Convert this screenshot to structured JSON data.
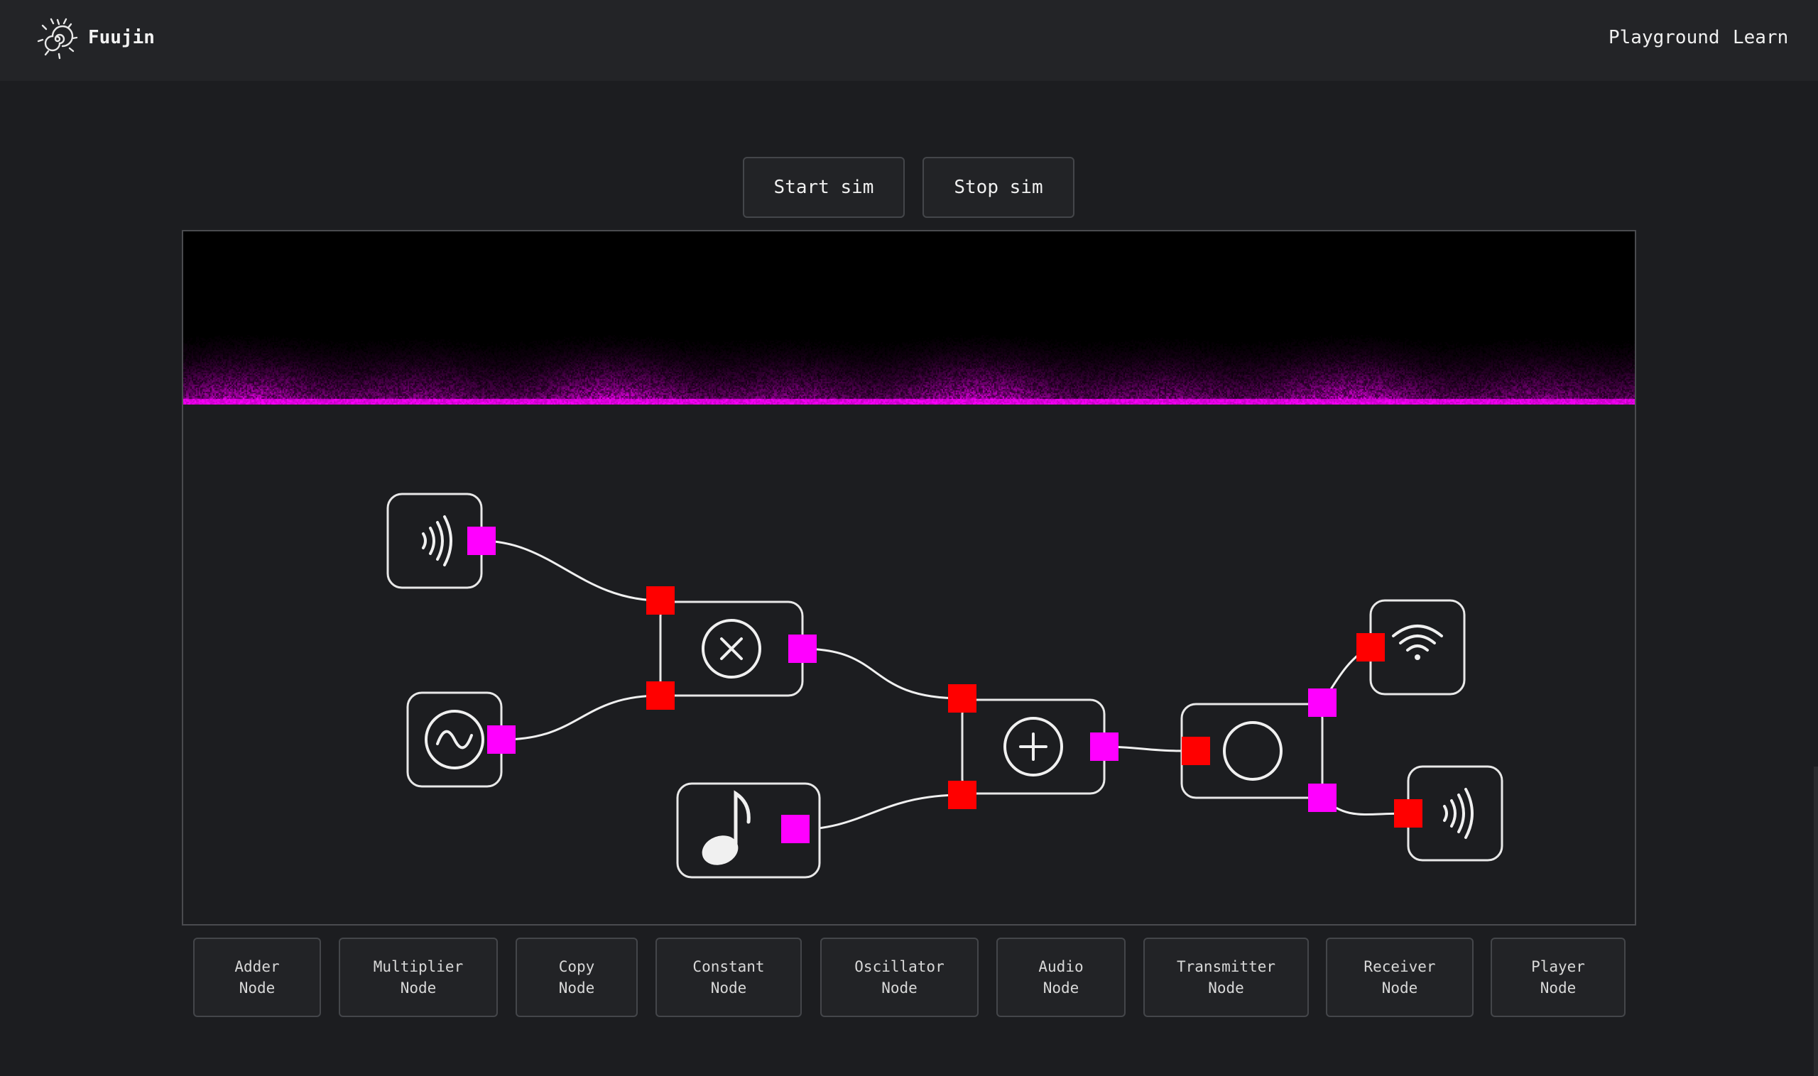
{
  "app": {
    "brand": "Fuujin",
    "logo_icon": "spiral-sun-logo"
  },
  "nav": {
    "items": [
      "Playground",
      "Learn"
    ]
  },
  "sim_controls": {
    "start_label": "Start sim",
    "stop_label": "Stop sim"
  },
  "colors": {
    "output_port": "#ff00ff",
    "input_port": "#ff0000",
    "spectrogram_accent": "#ff00ff",
    "background": "#1c1d20"
  },
  "graph": {
    "nodes": [
      {
        "id": "audio-node-1",
        "icon": "sound-waves-icon"
      },
      {
        "id": "oscillator-node",
        "icon": "sine-wave-icon"
      },
      {
        "id": "multiplier-node",
        "icon": "multiply-icon"
      },
      {
        "id": "constant-node",
        "icon": "music-note-icon"
      },
      {
        "id": "adder-node",
        "icon": "plus-icon"
      },
      {
        "id": "copy-node",
        "icon": "circle-icon"
      },
      {
        "id": "transmitter-node",
        "icon": "wifi-icon"
      },
      {
        "id": "player-node",
        "icon": "sound-waves-icon"
      }
    ]
  },
  "palette": {
    "buttons": [
      {
        "line1": "Adder",
        "line2": "Node"
      },
      {
        "line1": "Multiplier",
        "line2": "Node"
      },
      {
        "line1": "Copy",
        "line2": "Node"
      },
      {
        "line1": "Constant",
        "line2": "Node"
      },
      {
        "line1": "Oscillator",
        "line2": "Node"
      },
      {
        "line1": "Audio",
        "line2": "Node"
      },
      {
        "line1": "Transmitter",
        "line2": "Node"
      },
      {
        "line1": "Receiver",
        "line2": "Node"
      },
      {
        "line1": "Player",
        "line2": "Node"
      }
    ]
  }
}
